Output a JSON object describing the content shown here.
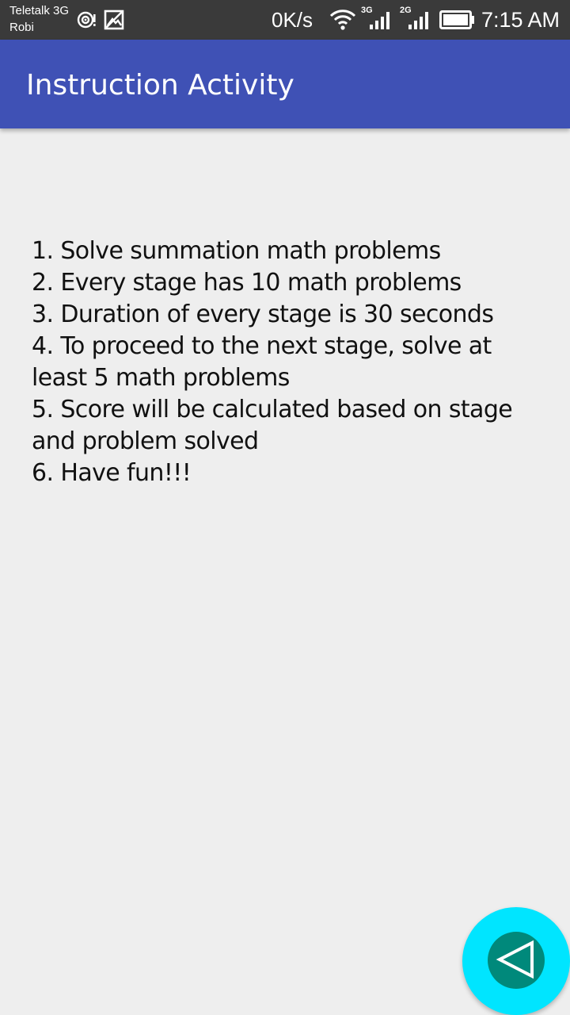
{
  "status_bar": {
    "carrier_1": "Teletalk 3G",
    "carrier_2": "Robi",
    "net_speed": "0K/s",
    "sim1_network": "3G",
    "sim2_network": "2G",
    "time": "7:15 AM",
    "icons": [
      "hotspot-icon",
      "image-notification-icon",
      "wifi-icon",
      "signal-icon",
      "signal-icon",
      "battery-icon"
    ]
  },
  "app_bar": {
    "title": "Instruction Activity",
    "color": "#3f51b5"
  },
  "instructions": {
    "text": "1. Solve summation math problems\n2. Every stage has 10 math problems\n3. Duration of every stage is 30 seconds\n4. To proceed to the next stage, solve at least 5 math problems\n5. Score will be calculated based on stage and problem solved\n6. Have fun!!!"
  },
  "fab": {
    "icon": "back-triangle-icon",
    "color": "#00e5ff",
    "inner_color": "#00897b"
  }
}
